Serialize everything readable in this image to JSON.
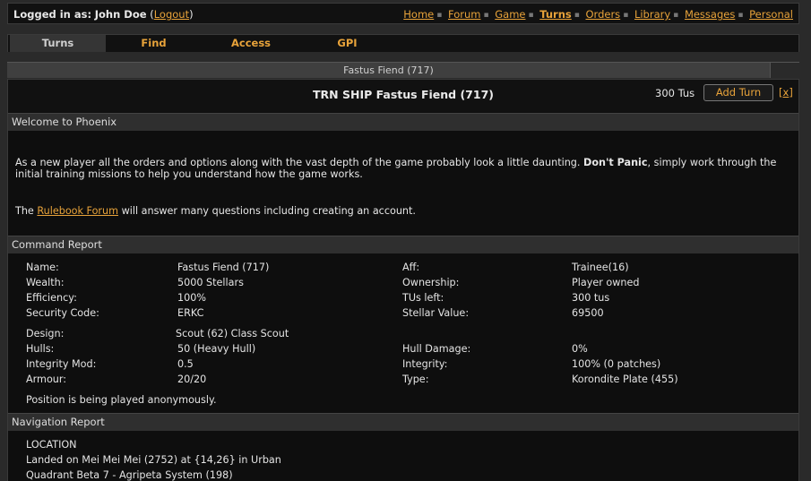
{
  "header": {
    "login_prefix": "Logged in as:",
    "user": "John Doe",
    "logout": "Logout",
    "nav": [
      "Home",
      "Forum",
      "Game",
      "Turns",
      "Orders",
      "Library",
      "Messages",
      "Personal"
    ]
  },
  "tabs": [
    "Turns",
    "Find",
    "Access",
    "GPI"
  ],
  "breadcrumb": "Fastus Fiend (717)",
  "panel": {
    "title": "TRN SHIP Fastus Fiend (717)",
    "tus": "300 Tus",
    "add_turn": "Add Turn",
    "close": "x"
  },
  "welcome": {
    "heading": "Welcome to Phoenix",
    "p1_start": "As a new player all the orders and options along with the vast depth of the game probably look a little daunting.",
    "p1_bold": "Don't Panic",
    "p1_end": ", simply work through the initial training missions to help you understand how the game works.",
    "p2_start": "The",
    "p2_link": "Rulebook Forum",
    "p2_end": "will answer many questions including creating an account."
  },
  "command": {
    "heading": "Command Report",
    "rows1": [
      {
        "l1": "Name:",
        "v1": "Fastus Fiend (717)",
        "l2": "Aff:",
        "v2": "Trainee(16)"
      },
      {
        "l1": "Wealth:",
        "v1": "5000 Stellars",
        "l2": "Ownership:",
        "v2": "Player owned"
      },
      {
        "l1": "Efficiency:",
        "v1": "100%",
        "l2": "TUs left:",
        "v2": "300 tus"
      },
      {
        "l1": "Security Code:",
        "v1": "ERKC",
        "l2": "Stellar Value:",
        "v2": "69500"
      }
    ],
    "design_label": "Design:",
    "design_value": "Scout (62) Class Scout",
    "rows2": [
      {
        "l1": "Hulls:",
        "v1": "50 (Heavy Hull)",
        "l2": "Hull Damage:",
        "v2": "0%"
      },
      {
        "l1": "Integrity Mod:",
        "v1": "0.5",
        "l2": "Integrity:",
        "v2": "100% (0 patches)"
      },
      {
        "l1": "Armour:",
        "v1": "20/20",
        "l2": "Type:",
        "v2": "Korondite Plate (455)"
      }
    ],
    "anon": "Position is being played anonymously."
  },
  "navigation": {
    "heading": "Navigation Report",
    "lines": [
      "LOCATION",
      "Landed on Mei Mei Mei (2752) at {14,26} in Urban",
      "Quadrant Beta 7 - Agripeta System (198)"
    ]
  },
  "colors": {
    "accent": "#e8a33a",
    "background": "#0e0e0e",
    "section": "#2f2f2f"
  }
}
